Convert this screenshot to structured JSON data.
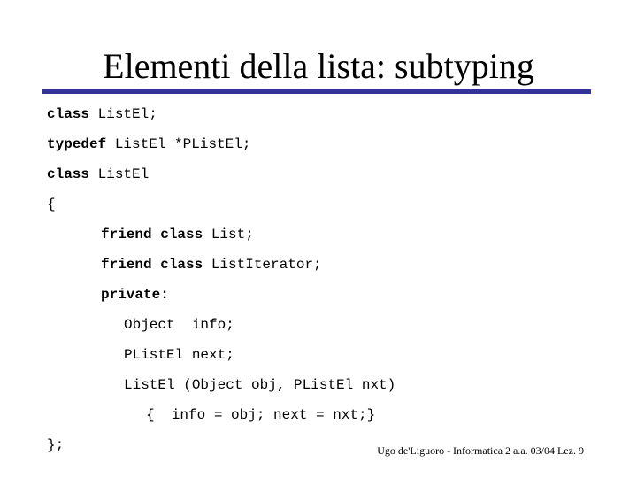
{
  "slide": {
    "title": "Elementi della lista: subtyping",
    "rule_color": "#333399",
    "background_color": "#ffffff",
    "text_color": "#000000",
    "footer": "Ugo de'Liguoro - Informatica 2 a.a. 03/04 Lez. 9"
  },
  "code": {
    "lines": [
      {
        "indent": 0,
        "keyword": "class",
        "rest": " ListEl;"
      },
      {
        "indent": 0,
        "keyword": "typedef",
        "rest": " ListEl *PListEl;"
      },
      {
        "indent": 0,
        "keyword": "class",
        "rest": " ListEl"
      },
      {
        "indent": 0,
        "keyword": "",
        "rest": "{"
      },
      {
        "indent": 1,
        "keyword": "friend class",
        "rest": " List;"
      },
      {
        "indent": 1,
        "keyword": "friend class",
        "rest": " ListIterator;"
      },
      {
        "indent": 1,
        "keyword": "private:",
        "rest": ""
      },
      {
        "indent": 2,
        "keyword": "",
        "rest": "Object  info;"
      },
      {
        "indent": 2,
        "keyword": "",
        "rest": "PListEl next;"
      },
      {
        "indent": 2,
        "keyword": "",
        "rest": "ListEl (Object obj, PListEl nxt)"
      },
      {
        "indent": 3,
        "keyword": "",
        "rest": "{  info = obj; next = nxt;}"
      },
      {
        "indent": 0,
        "keyword": "",
        "rest": "};"
      }
    ]
  }
}
